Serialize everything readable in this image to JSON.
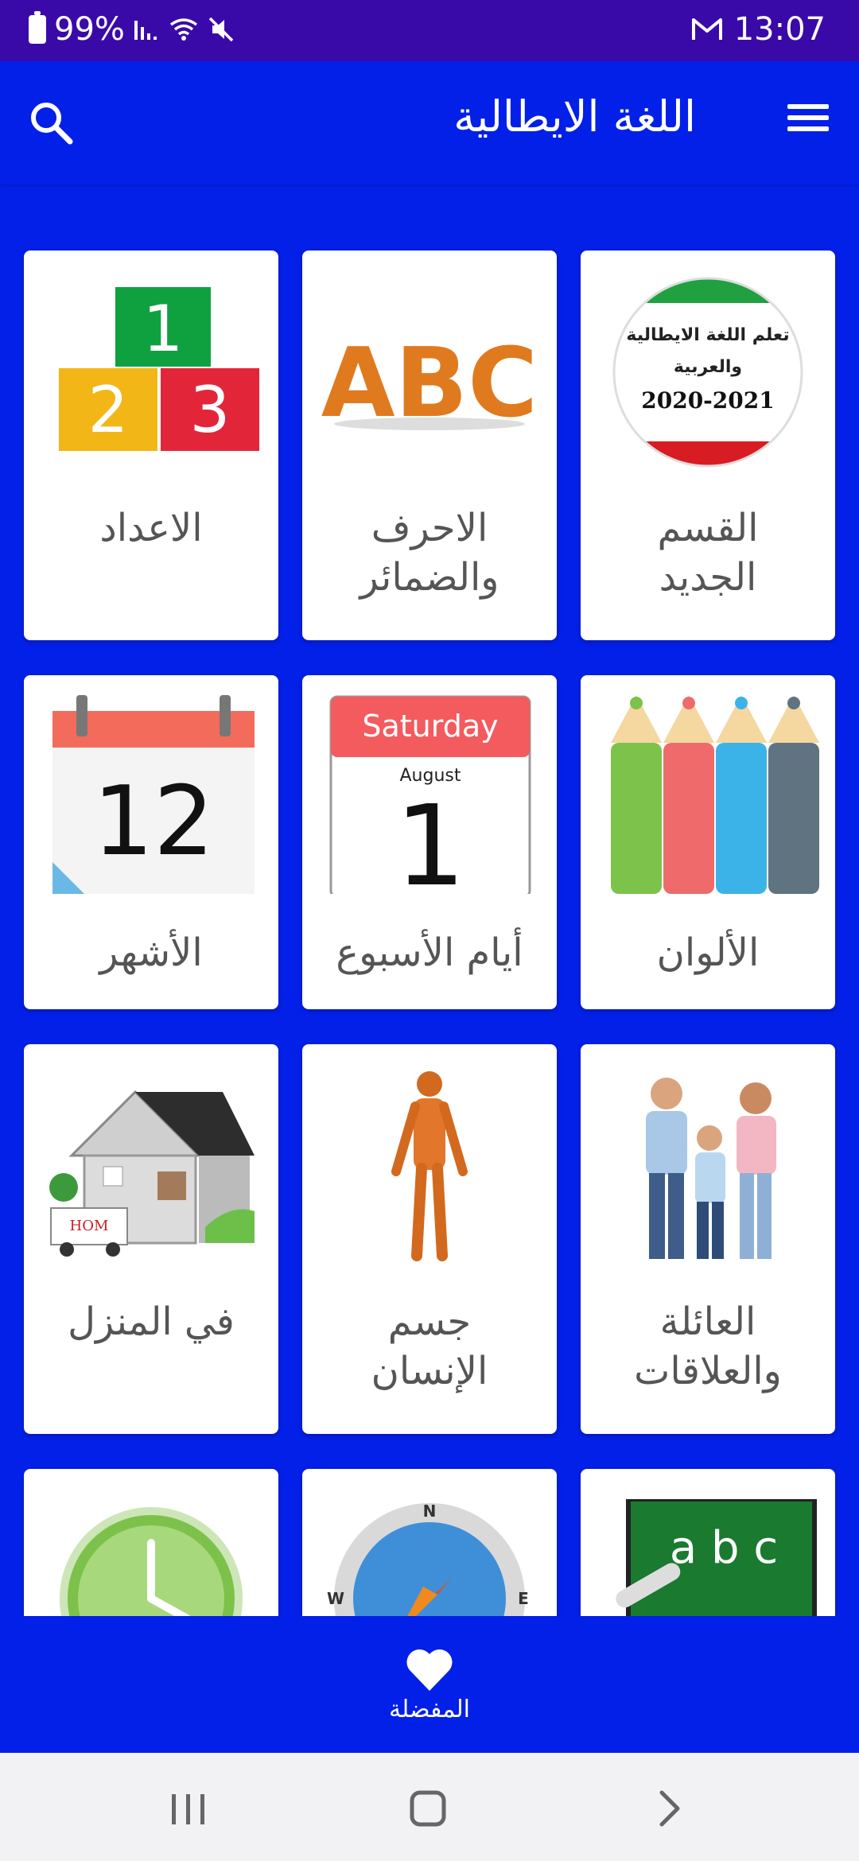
{
  "status_bar": {
    "battery": "99%",
    "time": "13:07",
    "icons": [
      "battery-icon",
      "signal-icon",
      "wifi-icon",
      "mute-icon",
      "gmail-icon"
    ]
  },
  "app_bar": {
    "title": "اللغة الايطالية",
    "search_icon": "search-icon",
    "menu_icon": "menu-icon"
  },
  "grid": {
    "items": [
      {
        "label_1": "القسم",
        "label_2": "الجديد",
        "badge_line_1": "تعلم اللغة الايطالية",
        "badge_line_2": "والعربية",
        "badge_year": "2020-2021"
      },
      {
        "label_1": "الاحرف",
        "label_2": "والضمائر",
        "image_text": "ABC"
      },
      {
        "label_1": "الاعداد",
        "label_2": "",
        "image_digits": [
          "1",
          "2",
          "3"
        ]
      },
      {
        "label_1": "الألوان",
        "label_2": ""
      },
      {
        "label_1": "أيام الأسبوع",
        "label_2": "",
        "cal_day": "Saturday",
        "cal_month": "August",
        "cal_date": "1"
      },
      {
        "label_1": "الأشهر",
        "label_2": "",
        "cal_number": "12"
      },
      {
        "label_1": "العائلة",
        "label_2": "والعلاقات"
      },
      {
        "label_1": "جسم",
        "label_2": "الإنسان"
      },
      {
        "label_1": "في المنزل",
        "label_2": "",
        "truck_text": "HOM"
      },
      {
        "label_1": "",
        "label_2": "",
        "board_text": "a b c"
      },
      {
        "label_1": "",
        "label_2": "",
        "compass_letters": [
          "N",
          "W",
          "E"
        ]
      },
      {
        "label_1": "",
        "label_2": ""
      }
    ]
  },
  "bottom_nav": {
    "favorites_label": "المفضلة",
    "favorites_icon": "heart-icon"
  },
  "system_nav": {
    "icons": [
      "recents-icon",
      "home-icon",
      "back-icon"
    ]
  },
  "colors": {
    "primary": "#0320e8",
    "status_bar": "#3a0aa8",
    "card": "#ffffff",
    "label": "#555555"
  }
}
